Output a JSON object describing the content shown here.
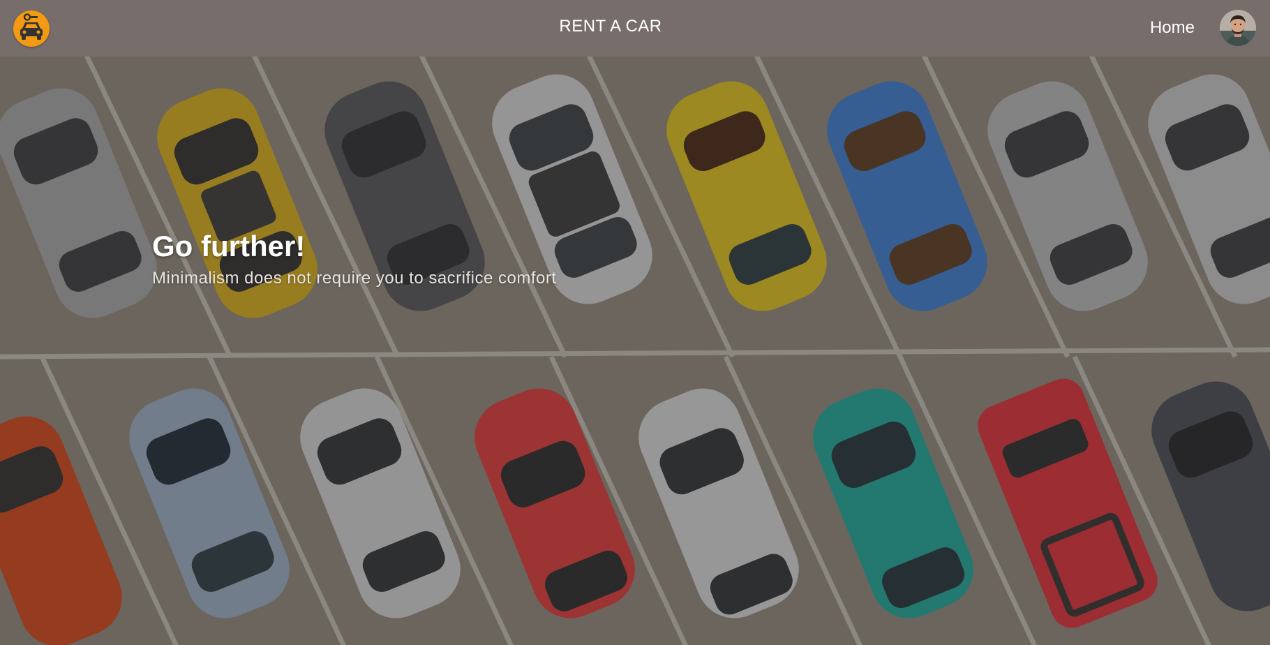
{
  "nav": {
    "brand": "RENT A CAR",
    "home_label": "Home",
    "logo_icon": "taxi-car-icon",
    "avatar_icon": "user-avatar-icon",
    "logo_color": "#f39a12",
    "bar_color": "#776e6c"
  },
  "hero": {
    "title": "Go further!",
    "subtitle": "Minimalism does not require you to sacrifice comfort",
    "background": "parking-lot-aerial-image",
    "car_colors_top_row": [
      "#a8a9ab",
      "#d9b01c",
      "#55565b",
      "#d6d7d8",
      "#e2c31d",
      "#3c7fd6",
      "#b9babd",
      "#c8c9cb"
    ],
    "car_colors_bottom_row": [
      "#d6461c",
      "#9db1c9",
      "#d5d6d8",
      "#df3b3b",
      "#d9dadc",
      "#1ea89d",
      "#e0313a",
      "#4a4c57"
    ]
  }
}
